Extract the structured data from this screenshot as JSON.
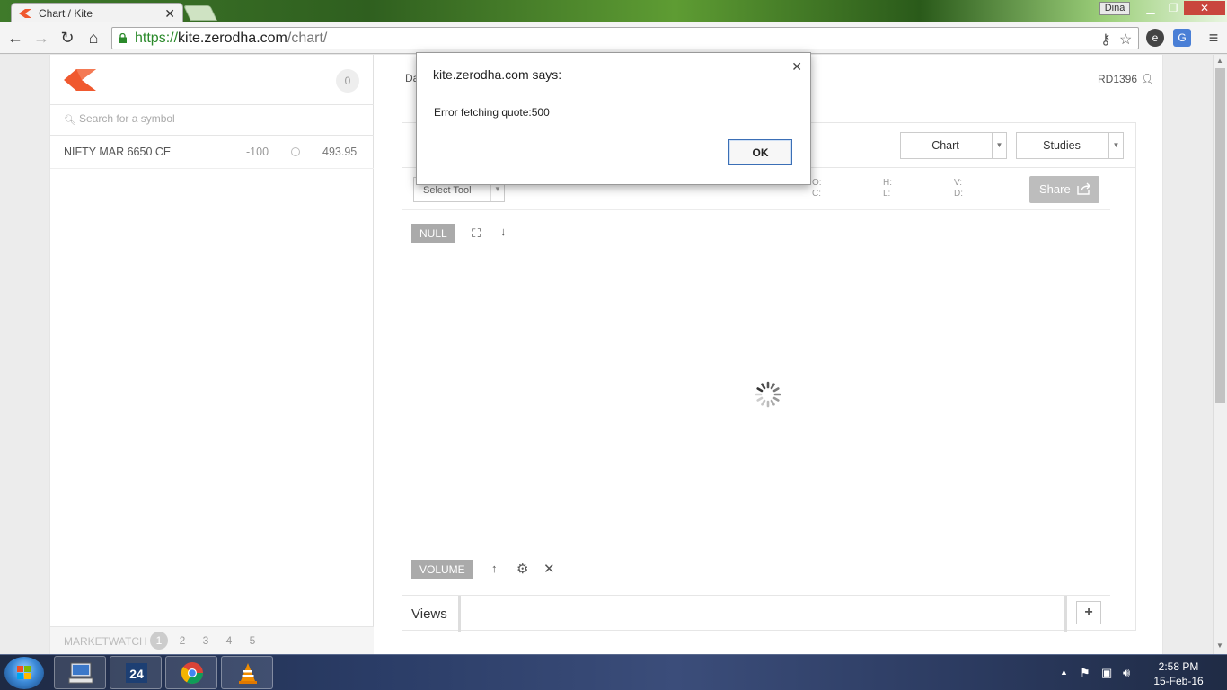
{
  "browser": {
    "tab_title": "Chart / Kite",
    "url_scheme": "https://",
    "url_host": "kite.zerodha.com",
    "url_path": "/chart/",
    "profile_name": "Dina"
  },
  "app": {
    "watchlist_count": "0",
    "search_placeholder": "Search for a symbol",
    "watchlist": [
      {
        "symbol": "NIFTY MAR 6650 CE",
        "change": "-100",
        "ltp": "493.95"
      }
    ],
    "marketwatch_label": "MARKETWATCH",
    "marketwatch_pages": [
      "1",
      "2",
      "3",
      "4",
      "5"
    ],
    "nav_partial": "Da",
    "user_id": "RD1396"
  },
  "chart": {
    "chart_dropdown": "Chart",
    "studies_dropdown": "Studies",
    "select_tool": "Select Tool",
    "ohlc": {
      "o": "O:",
      "c": "C:",
      "h": "H:",
      "l": "L:",
      "v": "V:",
      "d": "D:"
    },
    "share_label": "Share",
    "null_tag": "NULL",
    "volume_tag": "VOLUME",
    "views_label": "Views",
    "add_label": "+"
  },
  "dialog": {
    "title": "kite.zerodha.com says:",
    "message": "Error fetching quote:500",
    "ok_label": "OK"
  },
  "taskbar": {
    "time": "2:58 PM",
    "date": "15-Feb-16"
  },
  "colors": {
    "kite_orange": "#f0592f",
    "url_green": "#2b8a2b",
    "tag_gray": "#aaaaaa"
  }
}
